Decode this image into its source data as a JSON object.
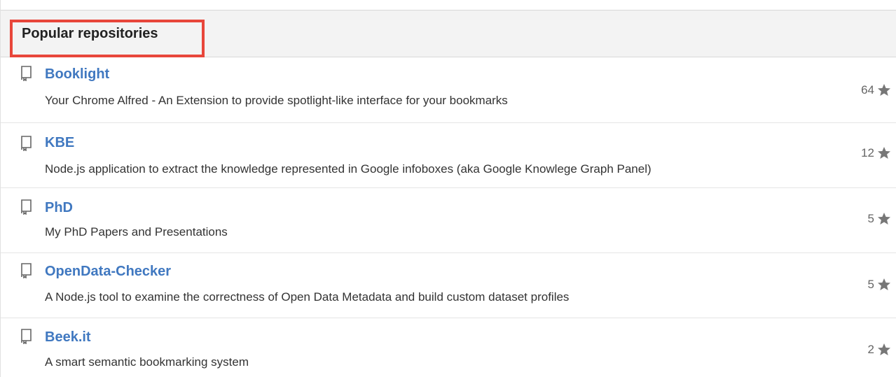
{
  "header": {
    "title": "Popular repositories"
  },
  "icons": {
    "repo": "repo-book-icon",
    "star": "star-icon"
  },
  "colors": {
    "link": "#4078c0",
    "highlight": "#e8463a",
    "header_bg": "#f3f3f3"
  },
  "repos": [
    {
      "name": "Booklight",
      "description": "Your Chrome Alfred - An Extension to provide spotlight-like interface for your bookmarks",
      "stars": "64"
    },
    {
      "name": "KBE",
      "description": "Node.js application to extract the knowledge represented in Google infoboxes (aka Google Knowlege Graph Panel)",
      "stars": "12"
    },
    {
      "name": "PhD",
      "description": "My PhD Papers and Presentations",
      "stars": "5"
    },
    {
      "name": "OpenData-Checker",
      "description": "A Node.js tool to examine the correctness of Open Data Metadata and build custom dataset profiles",
      "stars": "5"
    },
    {
      "name": "Beek.it",
      "description": "A smart semantic bookmarking system",
      "stars": "2"
    }
  ]
}
